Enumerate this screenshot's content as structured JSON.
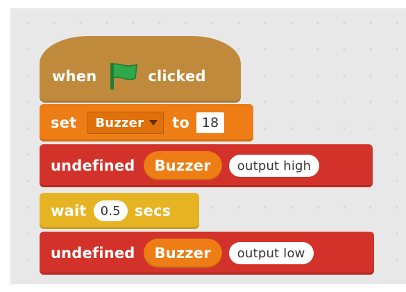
{
  "script": {
    "hat": {
      "when_label": "when",
      "icon": "green-flag-icon",
      "clicked_label": "clicked"
    },
    "set": {
      "set_label": "set",
      "variable": "Buzzer",
      "to_label": "to",
      "value": "18"
    },
    "output_high": {
      "label": "undefined",
      "pin": "Buzzer",
      "state": "output high"
    },
    "wait": {
      "wait_label": "wait",
      "seconds": "0.5",
      "secs_label": "secs"
    },
    "output_low": {
      "label": "undefined",
      "pin": "Buzzer",
      "state": "output low"
    }
  },
  "colors": {
    "events": "#bf8a3c",
    "data": "#ee7d16",
    "control": "#e6b422",
    "custom": "#d3322a",
    "flag": "#2fa84a",
    "background": "#e8e8e8"
  }
}
